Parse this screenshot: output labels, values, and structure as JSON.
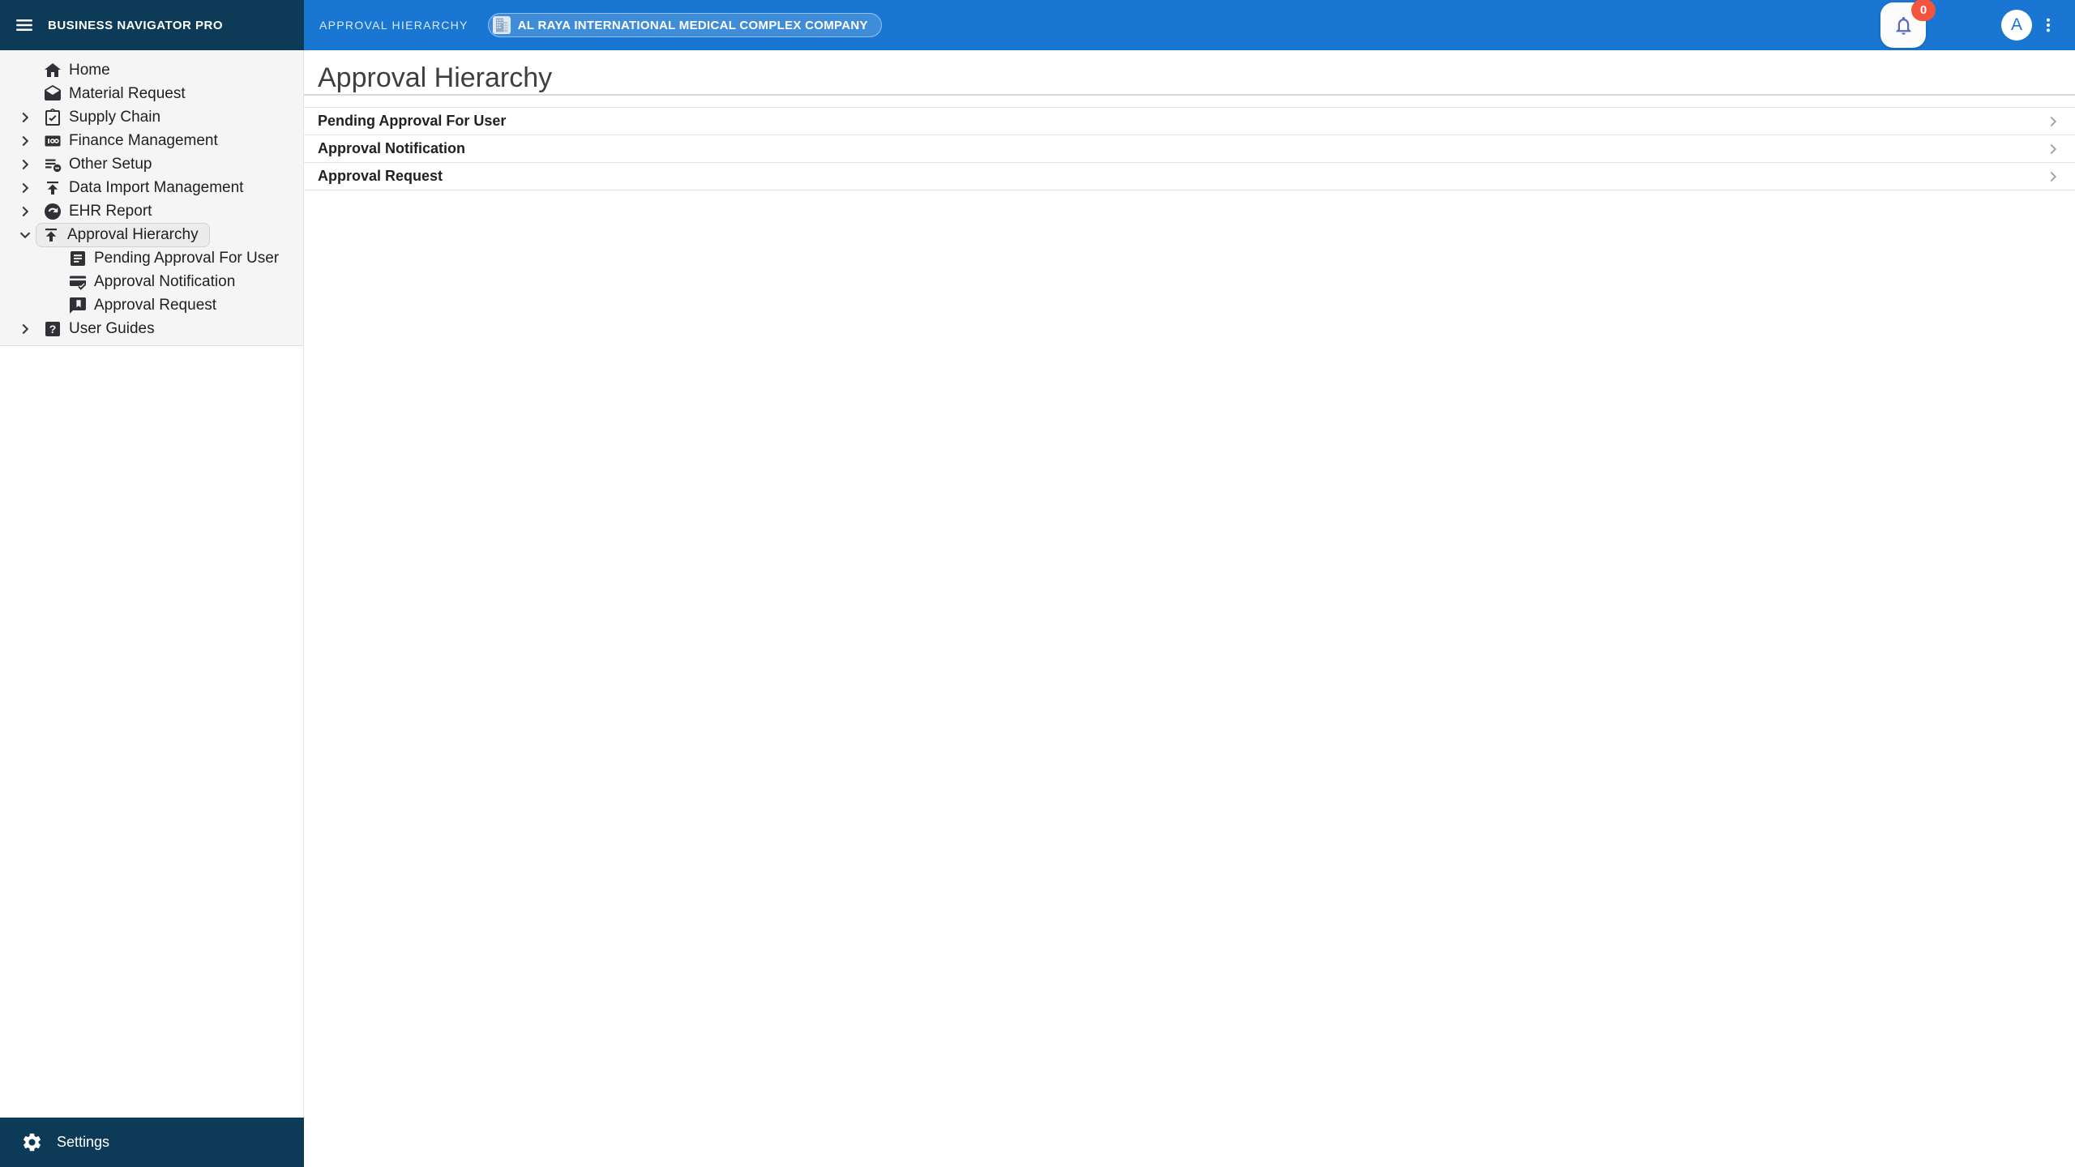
{
  "app": {
    "title": "BUSINESS NAVIGATOR PRO"
  },
  "topbar": {
    "breadcrumb": "APPROVAL HIERARCHY",
    "company": "AL RAYA INTERNATIONAL MEDICAL COMPLEX COMPANY",
    "notification_count": "0",
    "avatar_initial": "A"
  },
  "sidebar": {
    "items": [
      {
        "label": "Home",
        "icon": "home-icon",
        "expandable": false
      },
      {
        "label": "Material Request",
        "icon": "mail-icon",
        "expandable": false
      },
      {
        "label": "Supply Chain",
        "icon": "clipboard-check-icon",
        "expandable": true
      },
      {
        "label": "Finance Management",
        "icon": "money-icon",
        "expandable": true
      },
      {
        "label": "Other Setup",
        "icon": "list-remove-icon",
        "expandable": true
      },
      {
        "label": "Data Import Management",
        "icon": "upload-icon",
        "expandable": true
      },
      {
        "label": "EHR Report",
        "icon": "redo-circle-icon",
        "expandable": true
      },
      {
        "label": "Approval Hierarchy",
        "icon": "upload-icon",
        "expandable": true,
        "expanded": true,
        "selected": true,
        "children": [
          {
            "label": "Pending Approval For User",
            "icon": "article-icon"
          },
          {
            "label": "Approval Notification",
            "icon": "card-check-icon"
          },
          {
            "label": "Approval Request",
            "icon": "chat-bookmark-icon"
          }
        ]
      },
      {
        "label": "User Guides",
        "icon": "help-icon",
        "expandable": true
      }
    ],
    "footer": {
      "label": "Settings",
      "icon": "gear-icon"
    }
  },
  "main": {
    "title": "Approval Hierarchy",
    "rows": [
      "Pending Approval For User",
      "Approval Notification",
      "Approval Request"
    ]
  },
  "colors": {
    "sidebar_header": "#0d3a56",
    "topbar": "#1976d2",
    "badge": "#f2543d",
    "bell_icon": "#5c6bc0",
    "selected_item_bg": "#ececec",
    "nav_bg": "#f5f5f5",
    "divider": "#e4e4e4"
  }
}
